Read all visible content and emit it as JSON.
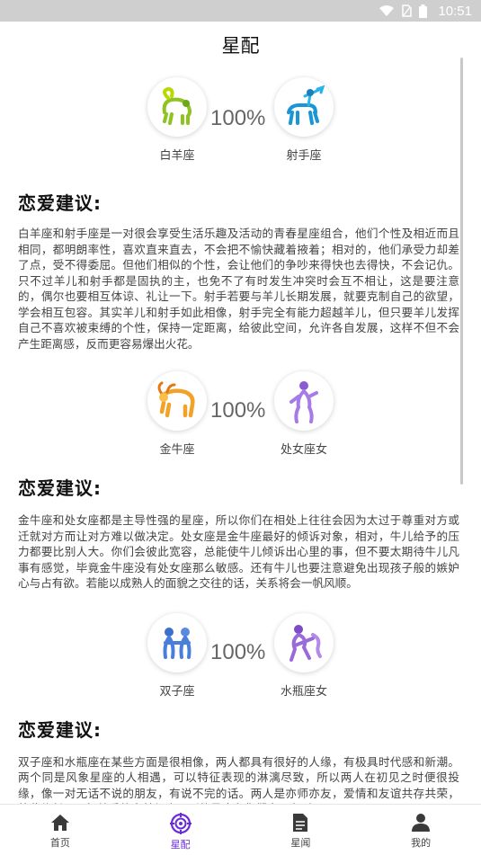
{
  "status_bar": {
    "time": "10:51"
  },
  "header": {
    "title": "星配"
  },
  "matches": [
    {
      "left_sign": "白羊座",
      "right_sign": "射手座",
      "percent": "100%",
      "advice_title": "恋爱建议:",
      "advice_text": "白羊座和射手座是一对很会享受生活乐趣及活动的青春星座组合，他们个性及相近而且相同，都明朗率性，喜欢直来直去，不会把不愉快藏着掖着；相对的，他们承受力却差了点，受不得委屈。但他们相似的个性，会让他们的争吵来得快也去得快，不会记仇。只不过羊儿和射手都是固执的主，也免不了有时发生冲突时会互不相让，这是要注意的，偶尔也要相互体谅、礼让一下。射手若要与羊儿长期发展，就要克制自己的欲望，学会相互包容。其实羊儿和射手如此相像，射手完全有能力超越羊儿，但只要羊儿发挥自己不喜欢被束缚的个性，保持一定距离，给彼此空间，允许各自发展，这样不但不会产生距离感，反而更容易爆出火花。"
    },
    {
      "left_sign": "金牛座",
      "right_sign": "处女座女",
      "percent": "100%",
      "advice_title": "恋爱建议:",
      "advice_text": "金牛座和处女座都是主导性强的星座，所以你们在相处上往往会因为太过于尊重对方或迁就对方而让对方难以做决定。处女座是金牛座最好的倾诉对象，相对，牛儿给予的压力都要比别人大。你们会彼此宽容，总能使牛儿倾诉出心里的事，但不要太期待牛儿凡事有感觉，毕竟金牛座没有处女座那么敏感。还有牛儿也要注意避免出现孩子般的嫉妒心与占有欲。若能以成熟人的面貌之交往的话，关系将会一帆风顺。"
    },
    {
      "left_sign": "双子座",
      "right_sign": "水瓶座女",
      "percent": "100%",
      "advice_title": "恋爱建议:",
      "advice_text": "双子座和水瓶座在某些方面是很相像，两人都具有很好的人缘，有极具时代感和新潮。两个同是风象星座的人相遇，可以特征表现的淋漓尽致，所以两人在初见之时便很投缘，像一对无话不说的朋友，有说不完的话。两人是亦师亦友，爱情和友谊共存共荣，彼此信任、互相尊重的完美组合。别的星座和你们交朋友时，"
    }
  ],
  "tabbar": {
    "items": [
      {
        "label": "首页",
        "icon": "home-icon"
      },
      {
        "label": "星配",
        "icon": "compass-icon",
        "active": true
      },
      {
        "label": "星闻",
        "icon": "document-icon"
      },
      {
        "label": "我的",
        "icon": "user-icon"
      }
    ]
  },
  "colors": {
    "accent": "#6a2bd9",
    "status_bar": "#cfcfcf"
  }
}
